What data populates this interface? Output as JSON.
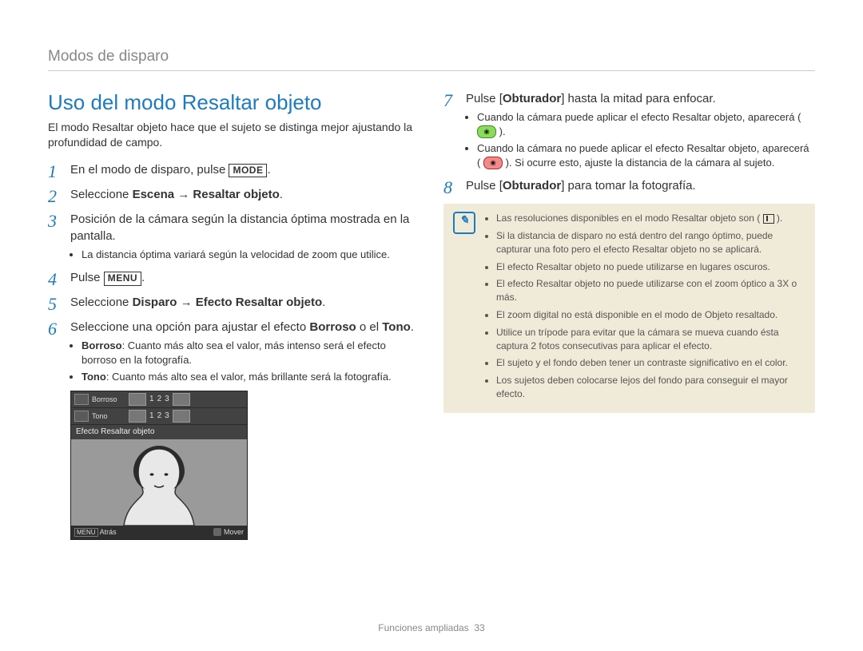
{
  "section_header": "Modos de disparo",
  "title": "Uso del modo Resaltar objeto",
  "intro": "El modo Resaltar objeto hace que el sujeto se distinga mejor ajustando la profundidad de campo.",
  "steps_left": {
    "s1": {
      "pre": "En el modo de disparo, pulse ",
      "btn": "MODE",
      "post": "."
    },
    "s2": {
      "pre": "Seleccione ",
      "bold": "Escena → Resaltar objeto",
      "post": "."
    },
    "s3": {
      "text": "Posición de la cámara según la distancia óptima mostrada en la pantalla.",
      "bullet": "La distancia óptima variará según la velocidad de zoom que utilice."
    },
    "s4": {
      "pre": "Pulse ",
      "btn": "MENU",
      "post": "."
    },
    "s5": {
      "pre": "Seleccione ",
      "bold": "Disparo → Efecto Resaltar objeto",
      "post": "."
    },
    "s6": {
      "pre": "Seleccione una opción para ajustar el efecto ",
      "bold1": "Borroso",
      "mid": " o el ",
      "bold2": "Tono",
      "post": ".",
      "bullets": [
        {
          "label": "Borroso",
          "text": ": Cuanto más alto sea el valor, más intenso será el efecto borroso en la fotografía."
        },
        {
          "label": "Tono",
          "text": ": Cuanto más alto sea el valor, más brillante será la fotografía."
        }
      ]
    }
  },
  "lcd": {
    "row1_label": "Borroso",
    "row1_values": [
      "1",
      "2",
      "3"
    ],
    "row2_label": "Tono",
    "row2_values": [
      "1",
      "2",
      "3"
    ],
    "title": "Efecto Resaltar objeto",
    "footer_back_btn": "MENU",
    "footer_back_text": "Atrás",
    "footer_move": "Mover"
  },
  "steps_right": {
    "s7": {
      "pre": "Pulse [",
      "bold": "Obturador",
      "post": "] hasta la mitad para enfocar.",
      "bullets": [
        "Cuando la cámara puede aplicar el efecto Resaltar objeto, aparecerá (",
        "Cuando la cámara no puede aplicar el efecto Resaltar objeto, aparecerá ("
      ],
      "b1_end": ").",
      "b2_end": "). Si ocurre esto, ajuste la distancia de la cámara al sujeto."
    },
    "s8": {
      "pre": "Pulse [",
      "bold": "Obturador",
      "post": "] para tomar la fotografía."
    }
  },
  "notes": [
    "Las resoluciones disponibles en el modo Resaltar objeto son (",
    "Si la distancia de disparo no está dentro del rango óptimo, puede capturar una foto pero el efecto Resaltar objeto no se aplicará.",
    "El efecto Resaltar objeto no puede utilizarse en lugares oscuros.",
    "El efecto Resaltar objeto no puede utilizarse con el zoom óptico a 3X o más.",
    "El zoom digital no está disponible en el modo de Objeto resaltado.",
    "Utilice un trípode para evitar que la cámara se mueva cuando ésta captura 2 fotos consecutivas para aplicar el efecto.",
    "El sujeto y el fondo deben tener un contraste significativo en el color.",
    "Los sujetos deben colocarse lejos del fondo para conseguir el mayor efecto."
  ],
  "note0_end": " ).",
  "footer_label": "Funciones ampliadas",
  "footer_page": "33"
}
